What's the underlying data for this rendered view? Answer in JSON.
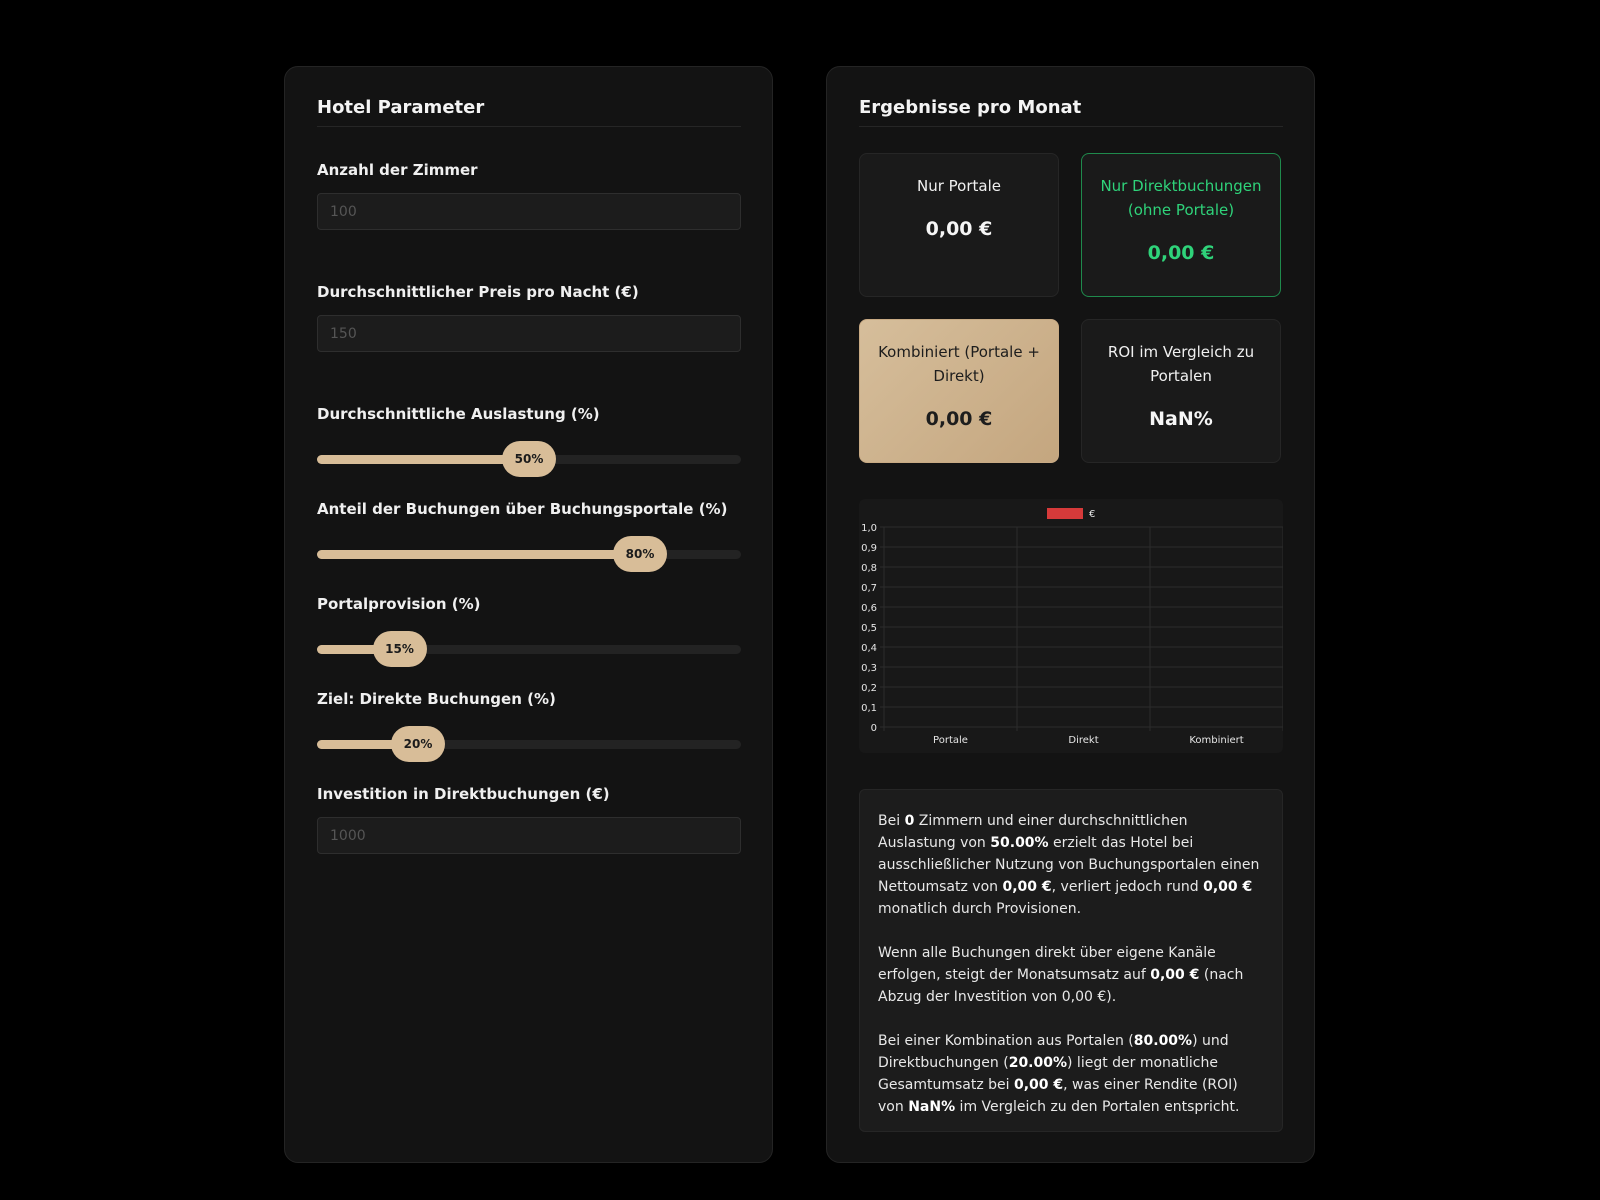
{
  "parameters": {
    "title": "Hotel Parameter",
    "rooms": {
      "label": "Anzahl der Zimmer",
      "placeholder": "100",
      "value": ""
    },
    "price": {
      "label": "Durchschnittlicher Preis pro Nacht (€)",
      "placeholder": "150",
      "value": ""
    },
    "occupancy": {
      "label": "Durchschnittliche Auslastung (%)",
      "value_percent": 50,
      "display": "50%"
    },
    "portal_share": {
      "label": "Anteil der Buchungen über Buchungsportale (%)",
      "value_percent": 80,
      "display": "80%"
    },
    "commission": {
      "label": "Portalprovision (%)",
      "value_percent": 15,
      "display": "15%"
    },
    "direct_target": {
      "label": "Ziel: Direkte Buchungen (%)",
      "value_percent": 20,
      "display": "20%"
    },
    "investment": {
      "label": "Investition in Direktbuchungen (€)",
      "placeholder": "1000",
      "value": ""
    }
  },
  "results": {
    "title": "Ergebnisse pro Monat",
    "portals": {
      "label": "Nur Portale",
      "value": "0,00 €"
    },
    "direct": {
      "label": "Nur Direktbuchungen (ohne Portale)",
      "value": "0,00 €"
    },
    "combined": {
      "label": "Kombiniert (Portale + Direkt)",
      "value": "0,00 €"
    },
    "roi": {
      "label": "ROI im Vergleich zu Portalen",
      "value": "NaN%"
    }
  },
  "chart_data": {
    "type": "bar",
    "categories": [
      "Portale",
      "Direkt",
      "Kombiniert"
    ],
    "series": [
      {
        "name": "€",
        "values": [
          0,
          0,
          0
        ],
        "color": "#d63a3a"
      }
    ],
    "ylim": [
      0,
      1
    ],
    "yticks": [
      "1,0",
      "0,9",
      "0,8",
      "0,7",
      "0,6",
      "0,5",
      "0,4",
      "0,3",
      "0,2",
      "0,1",
      "0"
    ],
    "grid": true,
    "legend": "top"
  },
  "summary": {
    "p1": [
      "Bei ",
      "0",
      " Zimmern und einer durchschnittlichen Auslastung von ",
      "50.00%",
      " erzielt das Hotel bei ausschließlicher Nutzung von Buchungsportalen einen Nettoumsatz von ",
      "0,00 €",
      ", verliert jedoch rund ",
      "0,00 €",
      " monatlich durch Provisionen."
    ],
    "p2": [
      "Wenn alle Buchungen direkt über eigene Kanäle erfolgen, steigt der Monatsumsatz auf ",
      "0,00 €",
      " (nach Abzug der Investition von 0,00 €)."
    ],
    "p3": [
      "Bei einer Kombination aus Portalen (",
      "80.00%",
      ") und Direktbuchungen (",
      "20.00%",
      ") liegt der monatliche Gesamtumsatz bei ",
      "0,00 €",
      ", was einer Rendite (ROI) von ",
      "NaN%",
      " im Vergleich zu den Portalen entspricht."
    ]
  },
  "colors": {
    "accent": "#d8bd98",
    "success": "#2fd37a",
    "panel": "#131313"
  }
}
